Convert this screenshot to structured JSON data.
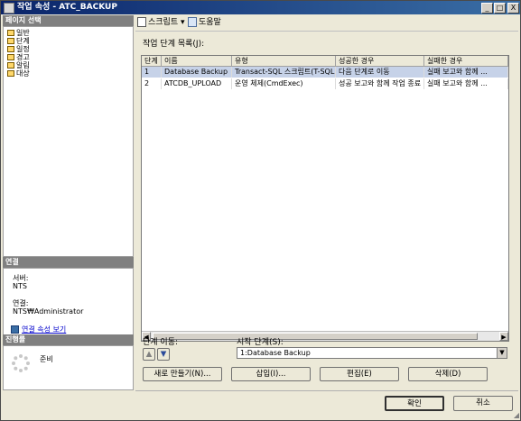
{
  "window": {
    "title": "작업 속성 - ATC_BACKUP",
    "controls": {
      "minimize": "_",
      "maximize": "□",
      "close": "X"
    }
  },
  "sidebar": {
    "page_select_header": "페이지 선택",
    "items": [
      {
        "label": "일반"
      },
      {
        "label": "단계"
      },
      {
        "label": "일정"
      },
      {
        "label": "경고"
      },
      {
        "label": "알림"
      },
      {
        "label": "대상"
      }
    ],
    "connection_header": "연결",
    "server_label": "서버:",
    "server_value": "NTS",
    "connection_label": "연결:",
    "connection_value": "NTS₩Administrator",
    "view_connection_link": "연결 속성 보기",
    "progress_header": "진행률",
    "progress_status": "준비"
  },
  "toolbar": {
    "script_label": "스크립트",
    "help_label": "도움말"
  },
  "main": {
    "steps_list_label": "작업 단계 목록(J):",
    "columns": [
      "단계",
      "이름",
      "유형",
      "성공한 경우",
      "실패한 경우"
    ],
    "rows": [
      [
        "1",
        "Database Backup",
        "Transact-SQL 스크립트(T-SQL)",
        "다음 단계로 이동",
        "실패 보고와 함께 ..."
      ],
      [
        "2",
        "ATCDB_UPLOAD",
        "운영 체제(CmdExec)",
        "성공 보고와 함께 작업 종료",
        "실패 보고와 함께 ..."
      ]
    ],
    "move_step_label": "단계 이동:",
    "start_step_label": "시작 단계(S):",
    "start_step_value": "1:Database Backup",
    "buttons": {
      "new": "새로 만들기(N)...",
      "insert": "삽입(I)...",
      "edit": "편집(E)",
      "delete": "삭제(D)"
    }
  },
  "footer": {
    "ok": "확인",
    "cancel": "취소"
  }
}
